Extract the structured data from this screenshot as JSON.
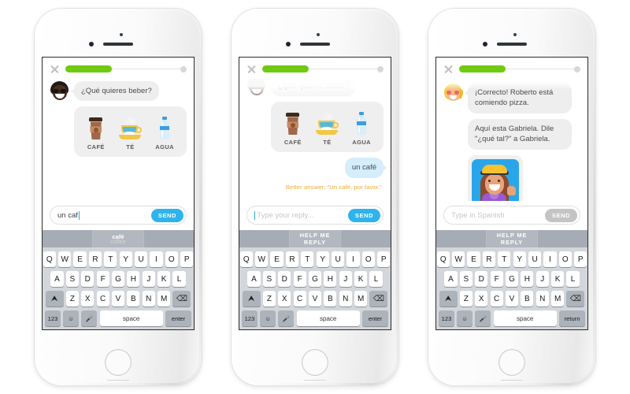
{
  "phones": [
    {
      "id": "phone-1",
      "name": "drink-question-typing",
      "topbar": {
        "close_icon": "close-x-icon",
        "progress_percent": 38
      },
      "messages": [
        {
          "type": "bot",
          "avatar": "roberto-dark-avatar",
          "text": "¿Qué quieres beber?"
        }
      ],
      "answer_card": {
        "options": [
          {
            "icon": "coffee-cup-icon",
            "label": "CAFÉ"
          },
          {
            "icon": "teacup-icon",
            "label": "TÉ"
          },
          {
            "icon": "water-bottle-icon",
            "label": "AGUA"
          }
        ]
      },
      "input": {
        "value": "un caf",
        "placeholder": "",
        "send_label": "SEND",
        "send_enabled": true
      },
      "keyboard": {
        "suggestion": {
          "type": "word",
          "word": "café",
          "translation": "coffee"
        },
        "row1": [
          "Q",
          "W",
          "E",
          "R",
          "T",
          "Y",
          "U",
          "I",
          "O",
          "P"
        ],
        "row2": [
          "A",
          "S",
          "D",
          "F",
          "G",
          "H",
          "J",
          "K",
          "L"
        ],
        "row3": [
          "Z",
          "X",
          "C",
          "V",
          "B",
          "N",
          "M"
        ],
        "shift_icon": "shift-arrow-icon",
        "backspace_icon": "backspace-icon",
        "numbers_label": "123",
        "emoji_icon": "emoji-smiley-icon",
        "mic_icon": "microphone-icon",
        "space_label": "space",
        "enter_label": "enter"
      }
    },
    {
      "id": "phone-2",
      "name": "drink-answer-feedback",
      "topbar": {
        "close_icon": "close-x-icon",
        "progress_percent": 38
      },
      "scrolled": true,
      "messages": [
        {
          "type": "bot",
          "avatar": "roberto-dark-avatar",
          "text": "¿Qué quieres beber?"
        },
        {
          "type": "user",
          "text": "un café"
        }
      ],
      "answer_card": {
        "options": [
          {
            "icon": "coffee-cup-icon",
            "label": "CAFÉ"
          },
          {
            "icon": "teacup-icon",
            "label": "TÉ"
          },
          {
            "icon": "water-bottle-icon",
            "label": "AGUA"
          }
        ]
      },
      "hint": "Better answer: \"Un café, por favor.\"",
      "input": {
        "value": "",
        "placeholder": "Type your reply...",
        "send_label": "SEND",
        "send_enabled": true
      },
      "keyboard": {
        "suggestion": {
          "type": "action",
          "label": "HELP ME REPLY"
        },
        "row1": [
          "Q",
          "W",
          "E",
          "R",
          "T",
          "Y",
          "U",
          "I",
          "O",
          "P"
        ],
        "row2": [
          "A",
          "S",
          "D",
          "F",
          "G",
          "H",
          "J",
          "K",
          "L"
        ],
        "row3": [
          "Z",
          "X",
          "C",
          "V",
          "B",
          "N",
          "M"
        ],
        "shift_icon": "shift-arrow-icon",
        "backspace_icon": "backspace-icon",
        "numbers_label": "123",
        "emoji_icon": "emoji-smiley-icon",
        "mic_icon": "microphone-icon",
        "space_label": "space",
        "enter_label": "enter"
      }
    },
    {
      "id": "phone-3",
      "name": "gabriela-introduction",
      "topbar": {
        "close_icon": "close-x-icon",
        "progress_percent": 38
      },
      "scrolled": true,
      "messages": [
        {
          "type": "bot",
          "avatar": "lucy-blonde-avatar",
          "text": "¡Correcto! Roberto está comiendo pizza."
        },
        {
          "type": "bot",
          "avatar": "none",
          "text": "Aquí esta Gabriela. Dile \"¿qué tal?\" a Gabriela."
        }
      ],
      "image_card": {
        "alt": "gabriela-waving-photo"
      },
      "input": {
        "value": "",
        "placeholder": "Type in Spanish",
        "send_label": "SEND",
        "send_enabled": false
      },
      "keyboard": {
        "suggestion": {
          "type": "action",
          "label": "HELP ME REPLY"
        },
        "row1": [
          "Q",
          "W",
          "E",
          "R",
          "T",
          "Y",
          "U",
          "I",
          "O",
          "P"
        ],
        "row2": [
          "A",
          "S",
          "D",
          "F",
          "G",
          "H",
          "J",
          "K",
          "L"
        ],
        "row3": [
          "Z",
          "X",
          "C",
          "V",
          "B",
          "N",
          "M"
        ],
        "shift_icon": "shift-arrow-icon",
        "backspace_icon": "backspace-icon",
        "numbers_label": "123",
        "emoji_icon": "emoji-smiley-icon",
        "mic_icon": "microphone-icon",
        "space_label": "space",
        "enter_label": "return"
      }
    }
  ],
  "colors": {
    "progress_green": "#6fca11",
    "send_blue": "#2fb3ec",
    "send_disabled": "#c4c4c4",
    "hint_orange": "#f0a92c",
    "bubble_gray": "#eeeeee",
    "bubble_blue": "#d6edfb",
    "keyboard_bg": "#d3d6db"
  }
}
